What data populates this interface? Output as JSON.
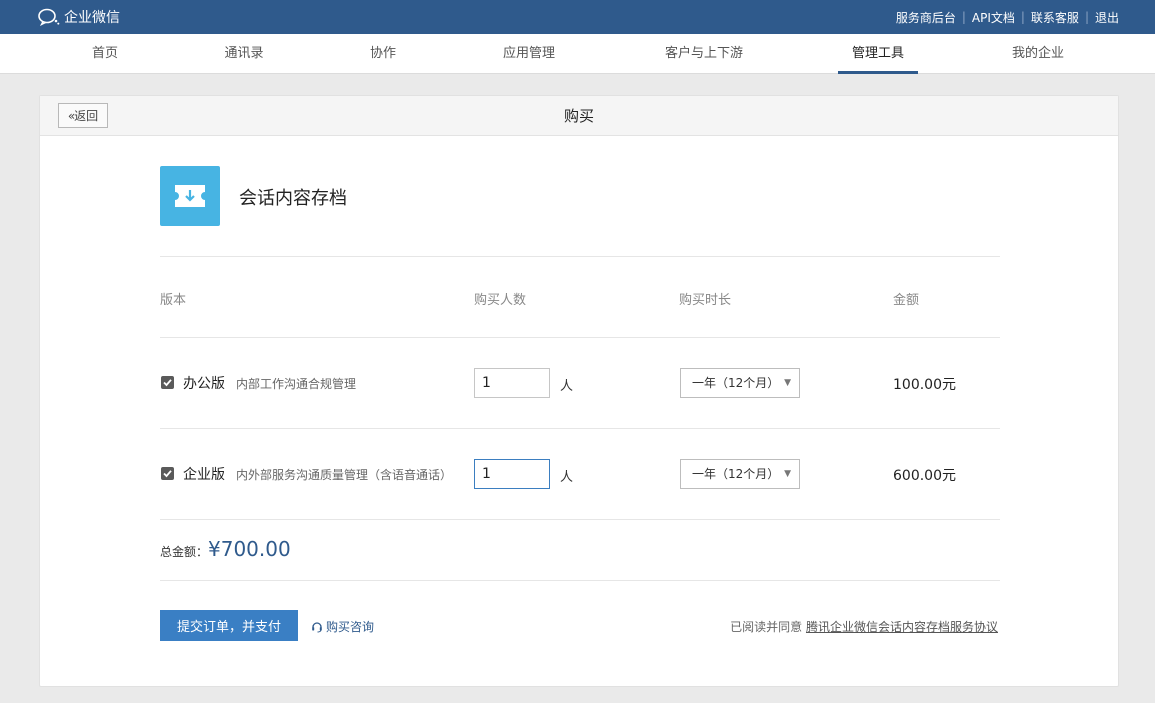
{
  "app": {
    "logo_text": "企业微信"
  },
  "top_links": [
    "服务商后台",
    "API文档",
    "联系客服",
    "退出"
  ],
  "nav": {
    "items": [
      "首页",
      "通讯录",
      "协作",
      "应用管理",
      "客户与上下游",
      "管理工具",
      "我的企业"
    ],
    "active": "管理工具"
  },
  "page": {
    "back_label": "返回",
    "title": "购买"
  },
  "product": {
    "name": "会话内容存档",
    "icon": "archive-download-icon"
  },
  "table": {
    "headers": [
      "版本",
      "购买人数",
      "购买时长",
      "金额"
    ],
    "rows": [
      {
        "checked": true,
        "name": "办公版",
        "desc": "内部工作沟通合规管理",
        "qty": "1",
        "unit": "人",
        "duration": "一年（12个月）",
        "amount": "100.00元"
      },
      {
        "checked": true,
        "name": "企业版",
        "desc": "内外部服务沟通质量管理（含语音通话）",
        "qty": "1",
        "unit": "人",
        "duration": "一年（12个月）",
        "amount": "600.00元"
      }
    ]
  },
  "total": {
    "label": "总金额：",
    "value": "¥700.00"
  },
  "actions": {
    "submit_label": "提交订单，并支付",
    "consult_label": "购买咨询",
    "agree_prefix": "已阅读并同意",
    "agree_link": "腾讯企业微信会话内容存档服务协议"
  },
  "colors": {
    "topbar": "#2f5a8c",
    "accent": "#3a7fc4",
    "product_icon": "#47b4e3"
  }
}
